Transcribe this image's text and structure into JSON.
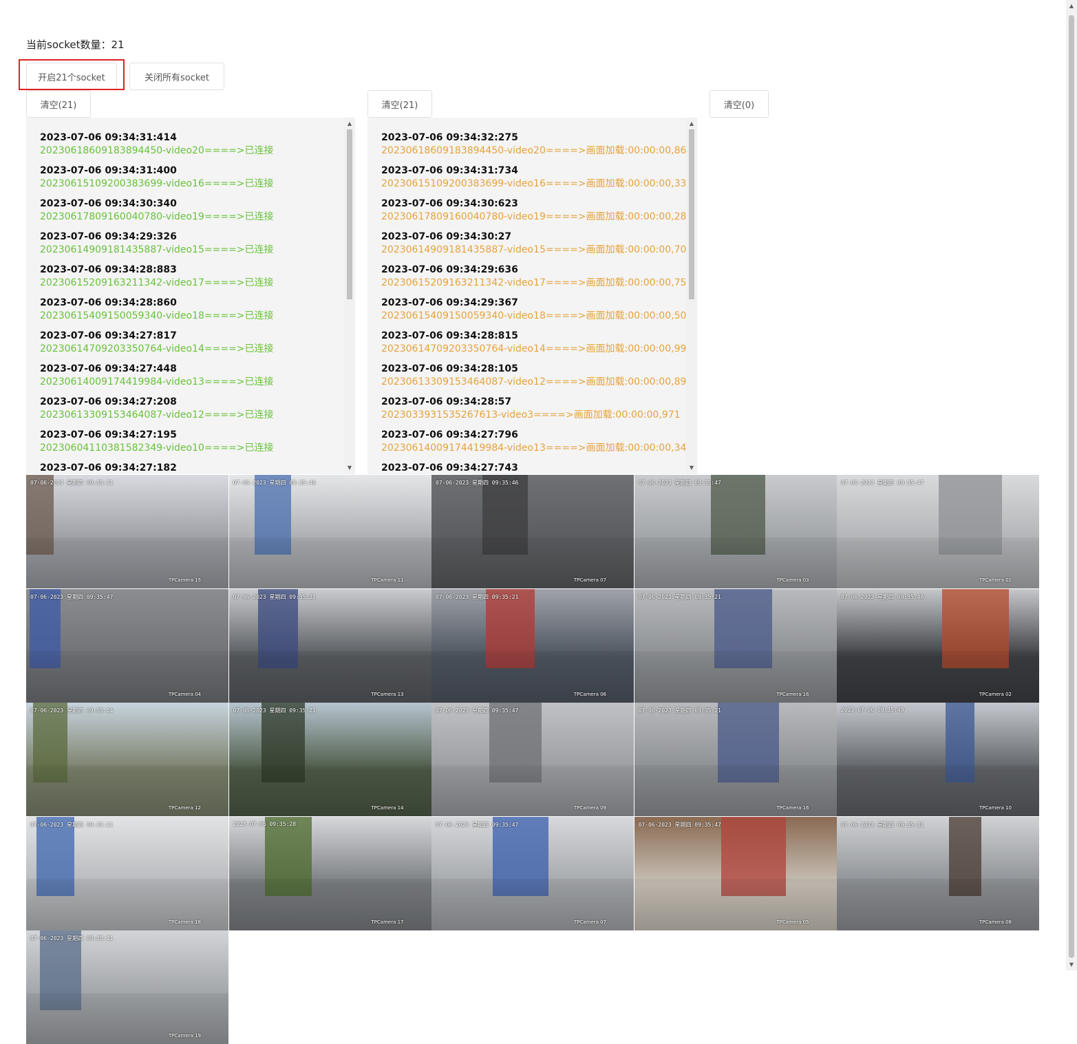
{
  "header": {
    "socket_count_label": "当前socket数量：",
    "socket_count": "21"
  },
  "buttons": {
    "open_label": "开启21个socket",
    "close_label": "关闭所有socket",
    "clear1_label": "清空(21)",
    "clear2_label": "清空(21)",
    "clear3_label": "清空(0)"
  },
  "log_connected": [
    {
      "time": "2023-07-06 09:34:31:414",
      "msg": "20230618609183894450-video20====>已连接"
    },
    {
      "time": "2023-07-06 09:34:31:400",
      "msg": "20230615109200383699-video16====>已连接"
    },
    {
      "time": "2023-07-06 09:34:30:340",
      "msg": "20230617809160040780-video19====>已连接"
    },
    {
      "time": "2023-07-06 09:34:29:326",
      "msg": "20230614909181435887-video15====>已连接"
    },
    {
      "time": "2023-07-06 09:34:28:883",
      "msg": "20230615209163211342-video17====>已连接"
    },
    {
      "time": "2023-07-06 09:34:28:860",
      "msg": "20230615409150059340-video18====>已连接"
    },
    {
      "time": "2023-07-06 09:34:27:817",
      "msg": "20230614709203350764-video14====>已连接"
    },
    {
      "time": "2023-07-06 09:34:27:448",
      "msg": "20230614009174419984-video13====>已连接"
    },
    {
      "time": "2023-07-06 09:34:27:208",
      "msg": "20230613309153464087-video12====>已连接"
    },
    {
      "time": "2023-07-06 09:34:27:195",
      "msg": "20230604110381582349-video10====>已连接"
    },
    {
      "time": "2023-07-06 09:34:27:182",
      "msg": ""
    }
  ],
  "log_loaded": [
    {
      "time": "2023-07-06 09:34:32:275",
      "msg": "20230618609183894450-video20====>画面加载:00:00:00,861"
    },
    {
      "time": "2023-07-06 09:34:31:734",
      "msg": "20230615109200383699-video16====>画面加载:00:00:00,334"
    },
    {
      "time": "2023-07-06 09:34:30:623",
      "msg": "20230617809160040780-video19====>画面加载:00:00:00,283"
    },
    {
      "time": "2023-07-06 09:34:30:27",
      "msg": "20230614909181435887-video15====>画面加载:00:00:00,701"
    },
    {
      "time": "2023-07-06 09:34:29:636",
      "msg": "20230615209163211342-video17====>画面加载:00:00:00,753"
    },
    {
      "time": "2023-07-06 09:34:29:367",
      "msg": "20230615409150059340-video18====>画面加载:00:00:00,507"
    },
    {
      "time": "2023-07-06 09:34:28:815",
      "msg": "20230614709203350764-video14====>画面加载:00:00:00,998"
    },
    {
      "time": "2023-07-06 09:34:28:105",
      "msg": "20230613309153464087-video12====>画面加载:00:00:00,897"
    },
    {
      "time": "2023-07-06 09:34:28:57",
      "msg": "2023033931535267613-video3====>画面加载:00:00:00,971"
    },
    {
      "time": "2023-07-06 09:34:27:796",
      "msg": "20230614009174419984-video13====>画面加载:00:00:00,349"
    },
    {
      "time": "2023-07-06 09:34:27:743",
      "msg": ""
    }
  ],
  "videos": [
    {
      "ts": "07-06-2023 星期四 09:35:21",
      "cam": "TPCamera 15",
      "colors": [
        "#d8dadf",
        "#9a9ca2",
        "#6b5a4e"
      ]
    },
    {
      "ts": "07-06-2023 星期四 09:35:46",
      "cam": "TPCamera 11",
      "colors": [
        "#e5e6e8",
        "#a9abaf",
        "#4a6fb0"
      ]
    },
    {
      "ts": "07-06-2023 星期四 09:35:46",
      "cam": "TPCamera 07",
      "colors": [
        "#6e7073",
        "#5a5c5f",
        "#3d3e40"
      ]
    },
    {
      "ts": "07-06-2023 星期四 09:35:47",
      "cam": "TPCamera 03",
      "colors": [
        "#c8cacd",
        "#9fa2a6",
        "#4f5a4a"
      ]
    },
    {
      "ts": "07-06-2023 星期四 09:35:47",
      "cam": "TPCamera 01",
      "colors": [
        "#d9dadc",
        "#b0b2b5",
        "#8e9094"
      ]
    },
    {
      "ts": "07-06-2023 星期四 09:35:47",
      "cam": "TPCamera 04",
      "colors": [
        "#8b8d91",
        "#707276",
        "#3b5aa8"
      ]
    },
    {
      "ts": "07-06-2023 星期四 09:35:21",
      "cam": "TPCamera 13",
      "colors": [
        "#c9cbcf",
        "#575a5e",
        "#3a4a80"
      ]
    },
    {
      "ts": "07-06-2023 星期四 09:35:21",
      "cam": "TPCamera 06",
      "colors": [
        "#9fa3a9",
        "#4e5560",
        "#b23a34"
      ]
    },
    {
      "ts": "07-06-2023 星期四 09:35:21",
      "cam": "TPCamera 16",
      "colors": [
        "#b8babd",
        "#8c8f93",
        "#4a5a8a"
      ]
    },
    {
      "ts": "07-06-2023 星期四 09:35:46",
      "cam": "TPCamera 02",
      "colors": [
        "#c5c7ca",
        "#3c3e42",
        "#b54a2a"
      ]
    },
    {
      "ts": "07-06-2023 星期四 09:35:24",
      "cam": "TPCamera 12",
      "colors": [
        "#c8d4de",
        "#7a7f6a",
        "#5b6b3e"
      ]
    },
    {
      "ts": "07-06-2023 星期四 09:35:21",
      "cam": "TPCamera 14",
      "colors": [
        "#b6c4cf",
        "#4d5a46",
        "#2f3b2a"
      ]
    },
    {
      "ts": "07-06-2023 星期四 09:35:47",
      "cam": "TPCamera 09",
      "colors": [
        "#bfc1c4",
        "#9b9da1",
        "#6e7074"
      ]
    },
    {
      "ts": "07-06-2023 星期四 09:35:21",
      "cam": "TPCamera 16",
      "colors": [
        "#b8babd",
        "#8c8f93",
        "#4a5a8a"
      ]
    },
    {
      "ts": "2023-07-06 09:35:49",
      "cam": "TPCamera 10",
      "colors": [
        "#c4c8ce",
        "#5e6165",
        "#3c5a96"
      ]
    },
    {
      "ts": "07-06-2023 星期四 09:35:21",
      "cam": "TPCamera 18",
      "colors": [
        "#e2e3e5",
        "#b7b9bc",
        "#3f67b0"
      ]
    },
    {
      "ts": "2023-07-06 09:35:28",
      "cam": "TPCamera 17",
      "colors": [
        "#d5d7da",
        "#7a7d80",
        "#4c6b2c"
      ]
    },
    {
      "ts": "07-06-2023 星期四 09:35:47",
      "cam": "TPCamera 07",
      "colors": [
        "#d6d8dc",
        "#a4a7ab",
        "#3a5fae"
      ]
    },
    {
      "ts": "07-06-2023 星期四 09:35:47",
      "cam": "TPCamera 05",
      "colors": [
        "#8a6a52",
        "#c9c2b8",
        "#b0423a"
      ]
    },
    {
      "ts": "07-06-2023 星期四 09:35:21",
      "cam": "TPCamera 08",
      "colors": [
        "#cfd1d4",
        "#8d9094",
        "#4a3a30"
      ]
    },
    {
      "ts": "07-06-2023 星期四 09:35:21",
      "cam": "TPCamera 19",
      "colors": [
        "#d2d4d7",
        "#9fa2a6",
        "#5a6e8a"
      ]
    }
  ]
}
